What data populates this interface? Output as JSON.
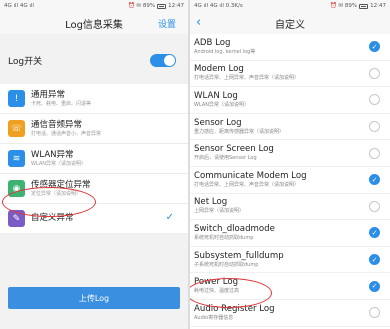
{
  "left": {
    "status": {
      "signal": "4G ıll 4G ıll",
      "time": "12:47",
      "indicators": "⏰ ✉ 89%"
    },
    "nav": {
      "title": "Log信息采集",
      "settings": "设置"
    },
    "switch_label": "Log开关",
    "items": [
      {
        "title": "通用异常",
        "subtitle": "卡死、耗电、重启、闪退等",
        "icon": "warning-icon",
        "color": "#2b8fe8"
      },
      {
        "title": "通信音频异常",
        "subtitle": "打电话、通话声音小、声音异常",
        "icon": "phone-audio-icon",
        "color": "#f0a020"
      },
      {
        "title": "WLAN异常",
        "subtitle": "WLAN异常（请加说明）",
        "icon": "wifi-icon",
        "color": "#2b8fe8"
      },
      {
        "title": "传感器定位异常",
        "subtitle": "定位异常（请加说明）",
        "icon": "location-icon",
        "color": "#3cb371"
      },
      {
        "title": "自定义异常",
        "subtitle": "",
        "icon": "edit-icon",
        "color": "#7b5cc4"
      }
    ],
    "upload_label": "上传Log"
  },
  "right": {
    "status": {
      "signal": "4G ıll 4G ıll 0.3K/s",
      "time": "12:47",
      "indicators": "⏰ ✉ 89%"
    },
    "nav": {
      "title": "自定义"
    },
    "logs": [
      {
        "name": "ADB Log",
        "desc": "Android log, kernel log等",
        "checked": true
      },
      {
        "name": "Modem Log",
        "desc": "打电话异常、上网异常、声音异常（请加说明）",
        "checked": false
      },
      {
        "name": "WLAN Log",
        "desc": "WLAN异常（请加说明）",
        "checked": false
      },
      {
        "name": "Sensor Log",
        "desc": "重力感应、距离传感器异常（请加说明）",
        "checked": false
      },
      {
        "name": "Sensor Screen Log",
        "desc": "开启后，请使用Sensor Log",
        "checked": false
      },
      {
        "name": "Communicate Modem Log",
        "desc": "打电话异常、上网异常、声音异常（请加说明）",
        "checked": true
      },
      {
        "name": "Net Log",
        "desc": "上网异常（请加说明）",
        "checked": false
      },
      {
        "name": "Switch_dloadmode",
        "desc": "系统死机时自动抓取dump",
        "checked": true
      },
      {
        "name": "Subsystem_fulldump",
        "desc": "子系统死机时自动抓取dump",
        "checked": true
      },
      {
        "name": "Power Log",
        "desc": "耗电过快、温度过高",
        "checked": true
      },
      {
        "name": "Audio Register Log",
        "desc": "Audio寄存器信息",
        "checked": false
      }
    ]
  }
}
